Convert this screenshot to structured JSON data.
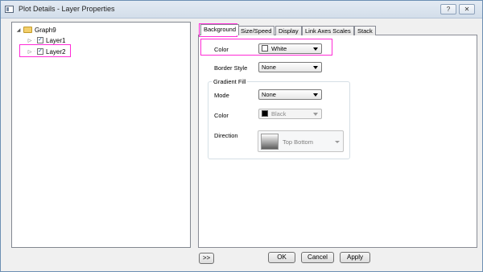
{
  "window": {
    "title": "Plot Details - Layer Properties"
  },
  "title_buttons": {
    "help": "?",
    "close": "✕"
  },
  "tree": {
    "root": {
      "label": "Graph9",
      "expander": "◢"
    },
    "items": [
      {
        "label": "Layer1",
        "checked": "✓"
      },
      {
        "label": "Layer2",
        "checked": "✓"
      }
    ]
  },
  "tabs": [
    {
      "label": "Background"
    },
    {
      "label": "Size/Speed"
    },
    {
      "label": "Display"
    },
    {
      "label": "Link Axes Scales"
    },
    {
      "label": "Stack"
    }
  ],
  "background_tab": {
    "color": {
      "label": "Color",
      "value": "White",
      "swatch": "#ffffff"
    },
    "border_style": {
      "label": "Border Style",
      "value": "None"
    },
    "gradient_fill": {
      "title": "Gradient Fill",
      "mode": {
        "label": "Mode",
        "value": "None"
      },
      "color": {
        "label": "Color",
        "value": "Black",
        "swatch": "#000000"
      },
      "direction": {
        "label": "Direction",
        "value": "Top Bottom"
      }
    }
  },
  "buttons": {
    "expand": ">>",
    "ok": "OK",
    "cancel": "Cancel",
    "apply": "Apply"
  },
  "colors": {
    "highlight": "#ff2bd6"
  }
}
